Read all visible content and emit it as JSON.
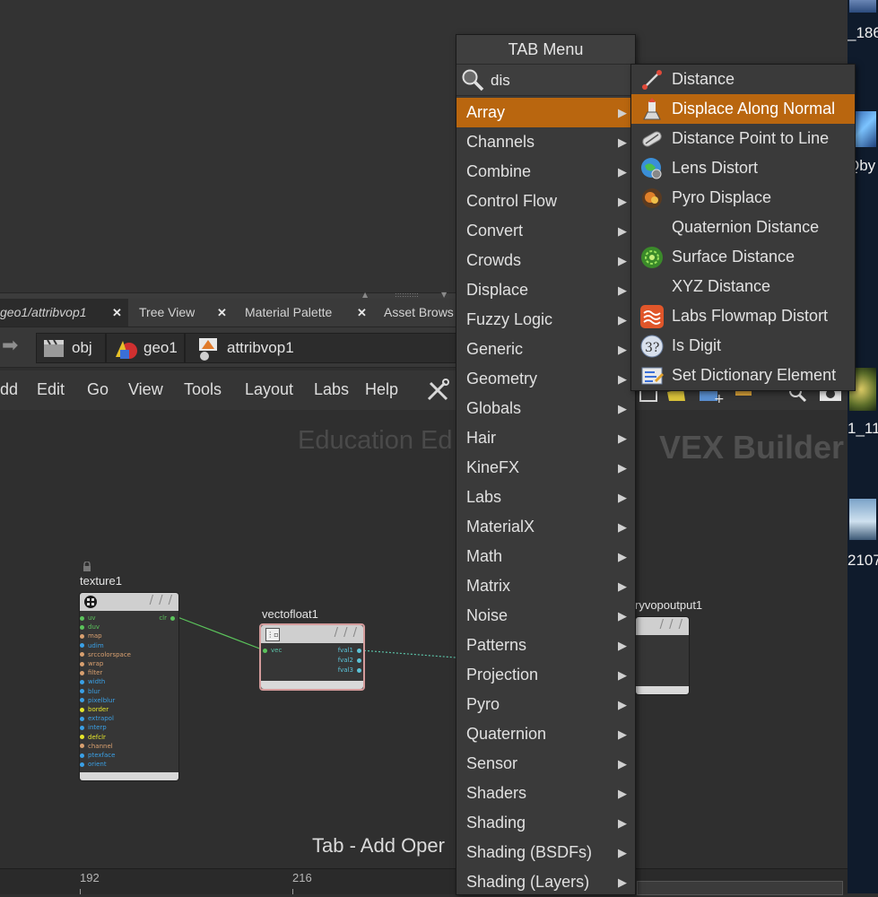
{
  "tabs": [
    {
      "label": "geo1/attribvop1",
      "active": true
    },
    {
      "label": "Tree View"
    },
    {
      "label": "Material Palette"
    },
    {
      "label": "Asset Brows"
    }
  ],
  "path": [
    "obj",
    "geo1",
    "attribvop1"
  ],
  "menubar": [
    "dd",
    "Edit",
    "Go",
    "View",
    "Tools",
    "Layout",
    "Labs",
    "Help"
  ],
  "watermarks": {
    "edition": "Education Ed",
    "context": "VEX Builder"
  },
  "hint": "Tab - Add Oper",
  "ruler": {
    "ticks": [
      "192",
      "216"
    ]
  },
  "desktop_labels": [
    "_186",
    "Qby",
    "1_11",
    "2107"
  ],
  "nodes": {
    "texture": {
      "name": "texture1",
      "inputs": [
        "uv",
        "duv",
        "map",
        "udim",
        "srccolorspace",
        "wrap",
        "filter",
        "width",
        "blur",
        "pixelblur",
        "border",
        "extrapol",
        "interp",
        "defclr",
        "channel",
        "ptexface",
        "orient"
      ],
      "input_colors": [
        "#5bc35b",
        "#5bc35b",
        "#d9a070",
        "#3aa0e6",
        "#d9a070",
        "#d9a070",
        "#d9a070",
        "#3aa0e6",
        "#3aa0e6",
        "#3aa0e6",
        "#e6e62a",
        "#3aa0e6",
        "#3aa0e6",
        "#e6e62a",
        "#d9a070",
        "#3aa0e6",
        "#3aa0e6"
      ],
      "output": "clr"
    },
    "vectofloat": {
      "name": "vectofloat1",
      "input": "vec",
      "outputs": [
        "fval1",
        "fval2",
        "fval3"
      ]
    },
    "output": {
      "name": "ryvopoutput1"
    }
  },
  "tab_menu": {
    "title": "TAB Menu",
    "search_value": "dis",
    "categories": [
      "Array",
      "Channels",
      "Combine",
      "Control Flow",
      "Convert",
      "Crowds",
      "Displace",
      "Fuzzy Logic",
      "Generic",
      "Geometry",
      "Globals",
      "Hair",
      "KineFX",
      "Labs",
      "MaterialX",
      "Math",
      "Matrix",
      "Noise",
      "Patterns",
      "Projection",
      "Pyro",
      "Quaternion",
      "Sensor",
      "Shaders",
      "Shading",
      "Shading (BSDFs)",
      "Shading (Layers)"
    ],
    "highlighted": "Array",
    "results": [
      "Distance",
      "Displace Along Normal",
      "Distance Point to Line",
      "Lens Distort",
      "Pyro Displace",
      "Quaternion Distance",
      "Surface Distance",
      "XYZ Distance",
      "Labs Flowmap Distort",
      "Is Digit",
      "Set Dictionary Element"
    ],
    "highlighted_result": "Displace Along Normal"
  },
  "colors": {
    "highlight": "#b9660f",
    "menu_bg": "#3a3a3a",
    "wire": "#5bc35b"
  }
}
